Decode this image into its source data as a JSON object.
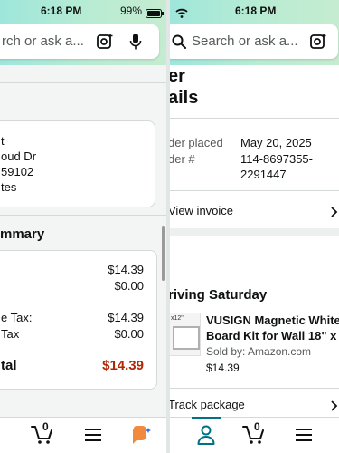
{
  "left": {
    "status": {
      "time": "6:18 PM",
      "battery": "99%"
    },
    "search": {
      "placeholder": "rch or ask a..."
    },
    "address": {
      "line1": "t",
      "line2": "oud Dr",
      "line3": "59102",
      "line4": "tes"
    },
    "summary": {
      "title": "mmary",
      "rows": [
        {
          "label": "",
          "value": "$14.39"
        },
        {
          "label": "",
          "value": "$0.00"
        },
        {
          "label": "e Tax:",
          "value": "$14.39"
        },
        {
          "label": "Tax",
          "value": "$0.00"
        }
      ],
      "total_label": "tal",
      "total_value": "$14.39"
    },
    "nav": {
      "cart_count": "0"
    }
  },
  "right": {
    "status": {
      "time": "6:18 PM"
    },
    "search": {
      "placeholder": "Search or ask a..."
    },
    "heading": {
      "line1": "er",
      "line2": "ails"
    },
    "order": {
      "placed_label": "der placed",
      "placed_value": "May 20, 2025",
      "number_label": "der #",
      "number_value_line1": "114-8697355-",
      "number_value_line2": "2291447"
    },
    "view_invoice": "View invoice",
    "delivery": {
      "title": "riving Saturday",
      "thumb_label": "x12\"",
      "product_line1": "VUSIGN Magnetic White",
      "product_line2": "Board Kit for Wall 18\" x",
      "seller": "Sold by: Amazon.com",
      "price": "$14.39"
    },
    "track_package": "Track package",
    "nav": {
      "cart_count": "0"
    }
  },
  "colors": {
    "total_red": "#b12704",
    "accent_teal": "#007185",
    "header_start": "#9ee6db",
    "header_end": "#c5ecd0"
  }
}
